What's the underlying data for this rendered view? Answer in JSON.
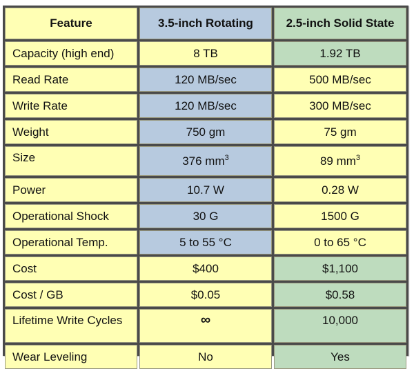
{
  "colors": {
    "yellow": "#ffffb4",
    "blue": "#b7cadf",
    "green": "#bedcbe",
    "border": "#4a4a4a"
  },
  "table": {
    "headers": [
      "Feature",
      "3.5-inch Rotating",
      "2.5-inch Solid State"
    ],
    "rows": [
      {
        "feature": "Capacity (high end)",
        "hdd": "8 TB",
        "ssd": "1.92 TB"
      },
      {
        "feature": "Read Rate",
        "hdd": "120 MB/sec",
        "ssd": "500 MB/sec"
      },
      {
        "feature": "Write Rate",
        "hdd": "120 MB/sec",
        "ssd": "300 MB/sec"
      },
      {
        "feature": "Weight",
        "hdd": "750 gm",
        "ssd": "75 gm"
      },
      {
        "feature": "Size",
        "hdd": "376 mm",
        "hdd_sup": "3",
        "ssd": "89 mm",
        "ssd_sup": "3"
      },
      {
        "feature": "Power",
        "hdd": "10.7 W",
        "ssd": "0.28 W"
      },
      {
        "feature": "Operational Shock",
        "hdd": "30 G",
        "ssd": "1500 G"
      },
      {
        "feature": "Operational Temp.",
        "hdd": "5 to 55 °C",
        "ssd": "0 to 65 °C"
      },
      {
        "feature": "Cost",
        "hdd": "$400",
        "ssd": "$1,100"
      },
      {
        "feature": "Cost / GB",
        "hdd": "$0.05",
        "ssd": "$0.58"
      },
      {
        "feature": "Lifetime Write Cycles",
        "hdd": "∞",
        "ssd": "10,000"
      },
      {
        "feature": "Wear Leveling",
        "hdd": "No",
        "ssd": "Yes"
      }
    ]
  }
}
